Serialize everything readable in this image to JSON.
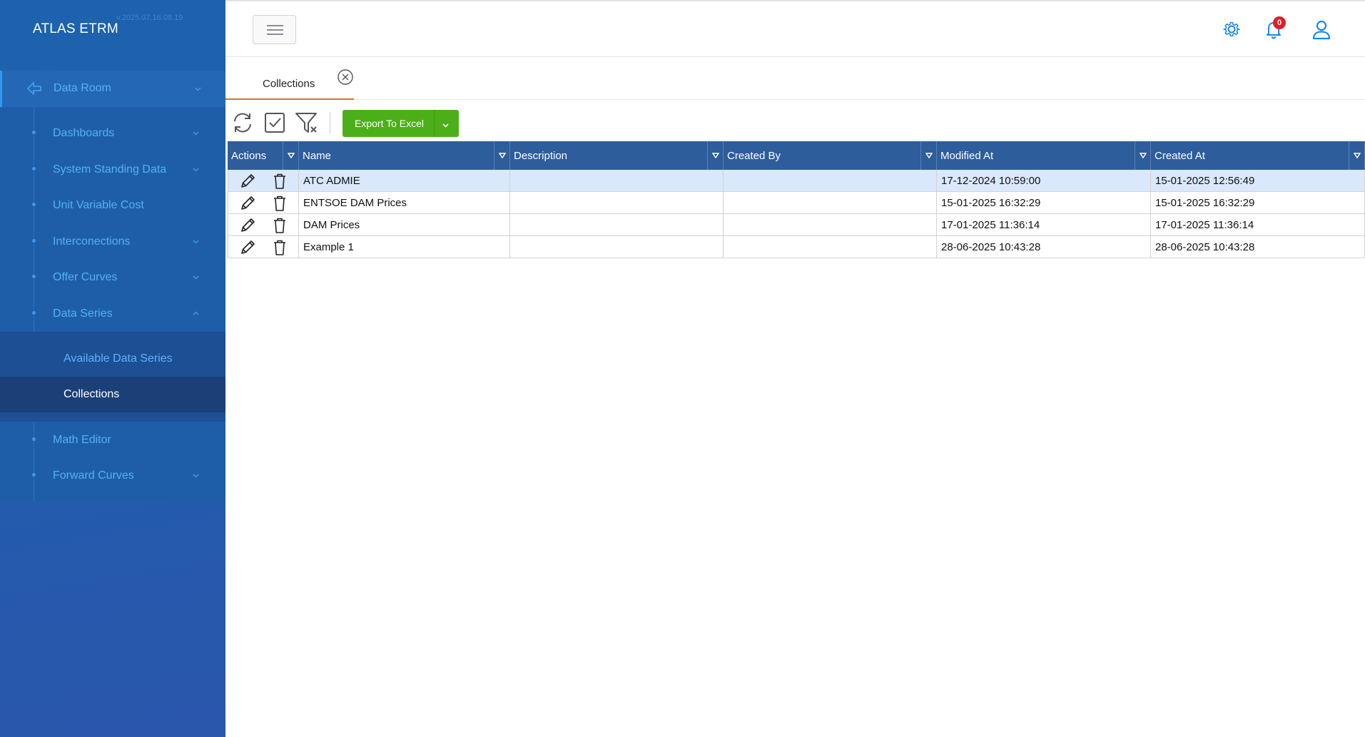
{
  "app": {
    "title": "ATLAS ETRM",
    "version": "v.2025.07.16.08.19"
  },
  "sidebar": {
    "root": {
      "label": "Data Room",
      "icon": "arrow-left-icon"
    },
    "items": [
      {
        "label": "Dashboards",
        "expandable": true
      },
      {
        "label": "System Standing Data",
        "expandable": true
      },
      {
        "label": "Unit Variable Cost",
        "expandable": false
      },
      {
        "label": "Interconections",
        "expandable": true
      },
      {
        "label": "Offer Curves",
        "expandable": true
      },
      {
        "label": "Data Series",
        "expandable": true,
        "expanded": true
      },
      {
        "label": "Math Editor",
        "expandable": false
      },
      {
        "label": "Forward Curves",
        "expandable": true
      }
    ],
    "subitems": [
      {
        "label": "Available Data Series",
        "active": false
      },
      {
        "label": "Collections",
        "active": true
      }
    ]
  },
  "header": {
    "notifications_count": "0",
    "icons": [
      "menu-icon",
      "gear-icon",
      "bell-icon",
      "user-icon"
    ]
  },
  "tabs": [
    {
      "label": "Collections",
      "closable": true
    }
  ],
  "toolbar": {
    "icons": [
      "refresh-icon",
      "checkbox-icon",
      "clear-filter-icon"
    ],
    "export_label": "Export To Excel"
  },
  "grid": {
    "columns": [
      "Actions",
      "Name",
      "Description",
      "Created By",
      "Modified At",
      "Created At"
    ],
    "rows": [
      {
        "name": "ATC ADMIE",
        "description": "",
        "created_by": "",
        "modified_at": "17-12-2024 10:59:00",
        "created_at": "15-01-2025 12:56:49",
        "selected": true
      },
      {
        "name": "ENTSOE DAM Prices",
        "description": "",
        "created_by": "",
        "modified_at": "15-01-2025 16:32:29",
        "created_at": "15-01-2025 16:32:29",
        "selected": false
      },
      {
        "name": "DAM Prices",
        "description": "",
        "created_by": "",
        "modified_at": "17-01-2025 11:36:14",
        "created_at": "17-01-2025 11:36:14",
        "selected": false
      },
      {
        "name": "Example 1",
        "description": "",
        "created_by": "",
        "modified_at": "28-06-2025 10:43:28",
        "created_at": "28-06-2025 10:43:28",
        "selected": false
      }
    ]
  },
  "colors": {
    "sidebar": "#1f5fae",
    "grid_header": "#2e5d9c",
    "export": "#4caf1a",
    "accent": "#1e88e5",
    "badge": "#e11d2a"
  }
}
